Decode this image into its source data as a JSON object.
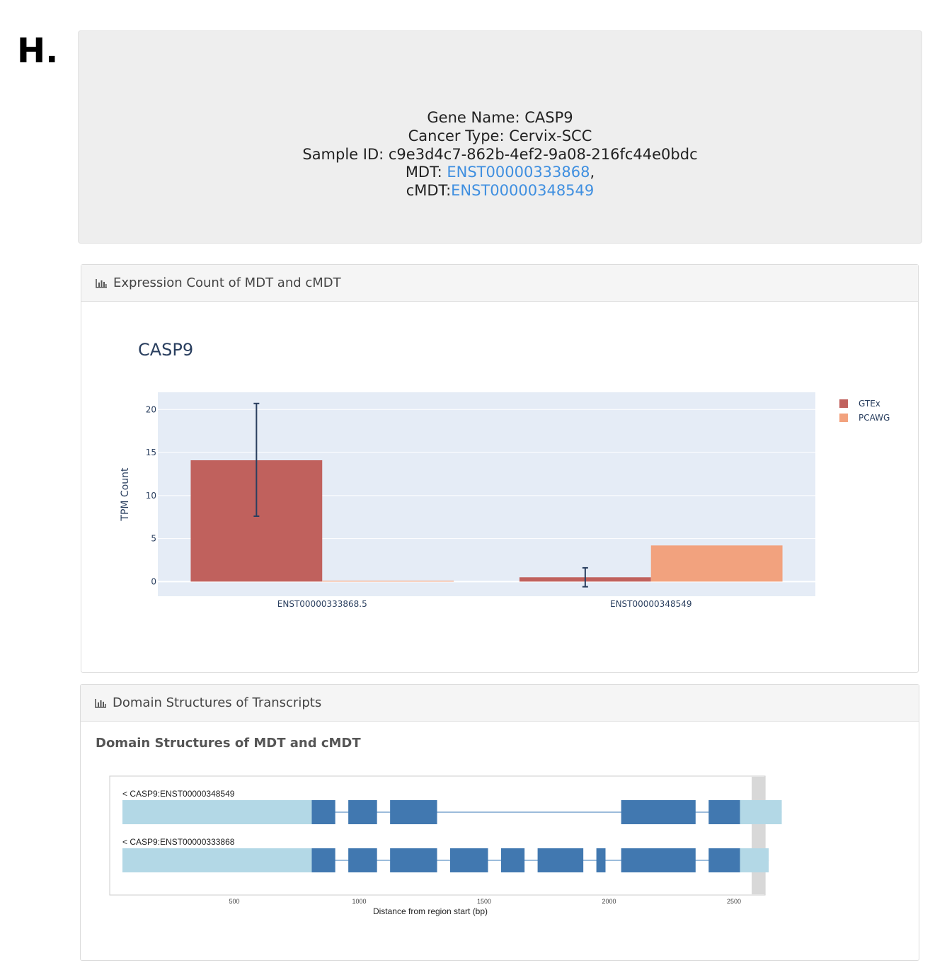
{
  "panel_label": "H.",
  "info": {
    "gene_name_line": "Gene Name: CASP9",
    "cancer_type_line": "Cancer Type: Cervix-SCC",
    "sample_id_line": "Sample ID: c9e3d4c7-862b-4ef2-9a08-216fc44e0bdc",
    "mdt_prefix": "MDT: ",
    "mdt_link": "ENST00000333868",
    "mdt_suffix": ",",
    "cmdt_prefix": "cMDT:",
    "cmdt_link": "ENST00000348549",
    "link_color": "#3f8fe0"
  },
  "expression_card": {
    "header": "Expression Count of MDT and cMDT",
    "header_icon": "bar-chart-icon"
  },
  "domain_card": {
    "header": "Domain Structures of Transcripts",
    "header_icon": "bar-chart-icon",
    "subtitle": "Domain Structures of MDT and cMDT"
  },
  "chart_data": [
    {
      "type": "bar",
      "title": "CASP9",
      "xlabel": "",
      "ylabel": "TPM Count",
      "categories": [
        "ENST00000333868.5",
        "ENST00000348549"
      ],
      "series": [
        {
          "name": "GTEx",
          "values": [
            14.1,
            0.5
          ],
          "error_high": [
            20.7,
            1.6
          ],
          "error_low": [
            7.6,
            -0.6
          ],
          "color": "#c0615d"
        },
        {
          "name": "PCAWG",
          "values": [
            0.1,
            4.2
          ],
          "color": "#f2a27e"
        }
      ],
      "ylim": [
        -1.7,
        22
      ],
      "yticks": [
        0,
        5,
        10,
        15,
        20
      ],
      "grid": true,
      "legend_position": "top-right",
      "plot_bg": "#e5ecf6"
    },
    {
      "type": "gene-structure",
      "xlabel": "Distance from region start (bp)",
      "xlim": [
        50,
        2560
      ],
      "xticks": [
        500,
        1000,
        1500,
        2000,
        2500
      ],
      "utr_color": "#b3d8e6",
      "cds_color": "#4178b0",
      "intron_color": "#7ba5cf",
      "tracks": [
        {
          "label": "< CASP9:ENST00000348549",
          "utr": [
            [
              0,
              725
            ],
            [
              2365,
              2525
            ]
          ],
          "cds": [
            [
              725,
              815
            ],
            [
              865,
              975
            ],
            [
              1025,
              1205
            ],
            [
              1910,
              2195
            ],
            [
              2245,
              2365
            ]
          ],
          "span": [
            0,
            2525
          ]
        },
        {
          "label": "< CASP9:ENST00000333868",
          "utr": [
            [
              0,
              725
            ],
            [
              2365,
              2475
            ]
          ],
          "cds": [
            [
              725,
              815
            ],
            [
              865,
              975
            ],
            [
              1025,
              1205
            ],
            [
              1255,
              1400
            ],
            [
              1450,
              1540
            ],
            [
              1590,
              1765
            ],
            [
              1815,
              1850
            ],
            [
              1910,
              2195
            ],
            [
              2245,
              2365
            ]
          ],
          "span": [
            0,
            2475
          ]
        }
      ]
    }
  ]
}
